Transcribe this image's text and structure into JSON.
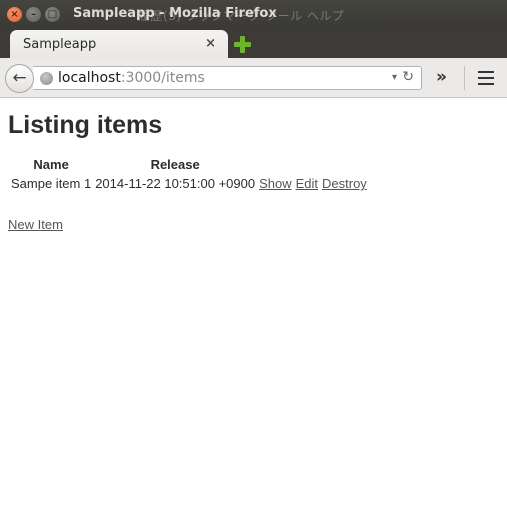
{
  "window": {
    "title": "Sampleapp - Mozilla Firefox",
    "menu_ghost": "履歴(S)  ブックマーク  ツール  ヘルプ",
    "close_glyph": "×",
    "min_glyph": "–",
    "max_glyph": "□"
  },
  "tab": {
    "label": "Sampleapp",
    "close_glyph": "×"
  },
  "navbar": {
    "back_glyph": "←",
    "url_host": "localhost",
    "url_path": ":3000/items",
    "dropdown_glyph": "▾",
    "reload_glyph": "↻",
    "overflow_glyph": "»"
  },
  "page": {
    "heading": "Listing items",
    "table": {
      "headers": [
        "Name",
        "Release",
        "",
        "",
        ""
      ],
      "rows": [
        {
          "name": "Sampe item 1",
          "release": "2014-11-22 10:51:00 +0900",
          "show": "Show",
          "edit": "Edit",
          "destroy": "Destroy"
        }
      ]
    },
    "new_item_link": "New Item"
  },
  "colors": {
    "newtab_plus": "#6fb52c",
    "titlebar": "#3c3b37",
    "close_button": "#e05a2b"
  }
}
